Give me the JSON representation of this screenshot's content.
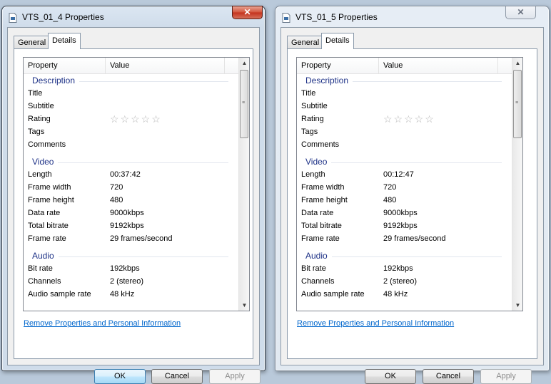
{
  "windows": [
    {
      "title": "VTS_01_4 Properties",
      "close_label": "✕",
      "tabs": {
        "general": "General",
        "details": "Details"
      },
      "columns": {
        "property": "Property",
        "value": "Value"
      },
      "description": {
        "heading": "Description",
        "title": "Title",
        "subtitle": "Subtitle",
        "rating": "Rating",
        "rating_stars": "☆☆☆☆☆",
        "tags": "Tags",
        "comments": "Comments"
      },
      "video": {
        "heading": "Video",
        "length_label": "Length",
        "length": "00:37:42",
        "frame_width_label": "Frame width",
        "frame_width": "720",
        "frame_height_label": "Frame height",
        "frame_height": "480",
        "data_rate_label": "Data rate",
        "data_rate": "9000kbps",
        "total_bitrate_label": "Total bitrate",
        "total_bitrate": "9192kbps",
        "frame_rate_label": "Frame rate",
        "frame_rate": "29 frames/second"
      },
      "audio": {
        "heading": "Audio",
        "bit_rate_label": "Bit rate",
        "bit_rate": "192kbps",
        "channels_label": "Channels",
        "channels": "2 (stereo)",
        "sample_rate_label": "Audio sample rate",
        "sample_rate": "48 kHz"
      },
      "remove_link": "Remove Properties and Personal Information",
      "buttons": {
        "ok": "OK",
        "cancel": "Cancel",
        "apply": "Apply"
      }
    },
    {
      "title": "VTS_01_5 Properties",
      "close_label": "✕",
      "tabs": {
        "general": "General",
        "details": "Details"
      },
      "columns": {
        "property": "Property",
        "value": "Value"
      },
      "description": {
        "heading": "Description",
        "title": "Title",
        "subtitle": "Subtitle",
        "rating": "Rating",
        "rating_stars": "☆☆☆☆☆",
        "tags": "Tags",
        "comments": "Comments"
      },
      "video": {
        "heading": "Video",
        "length_label": "Length",
        "length": "00:12:47",
        "frame_width_label": "Frame width",
        "frame_width": "720",
        "frame_height_label": "Frame height",
        "frame_height": "480",
        "data_rate_label": "Data rate",
        "data_rate": "9000kbps",
        "total_bitrate_label": "Total bitrate",
        "total_bitrate": "9192kbps",
        "frame_rate_label": "Frame rate",
        "frame_rate": "29 frames/second"
      },
      "audio": {
        "heading": "Audio",
        "bit_rate_label": "Bit rate",
        "bit_rate": "192kbps",
        "channels_label": "Channels",
        "channels": "2 (stereo)",
        "sample_rate_label": "Audio sample rate",
        "sample_rate": "48 kHz"
      },
      "remove_link": "Remove Properties and Personal Information",
      "buttons": {
        "ok": "OK",
        "cancel": "Cancel",
        "apply": "Apply"
      }
    }
  ],
  "icons": {
    "title": "file-video-icon",
    "scroll_up": "scroll-up-arrow-icon",
    "scroll_down": "scroll-down-arrow-icon",
    "grip": "scroll-grip-icon"
  }
}
